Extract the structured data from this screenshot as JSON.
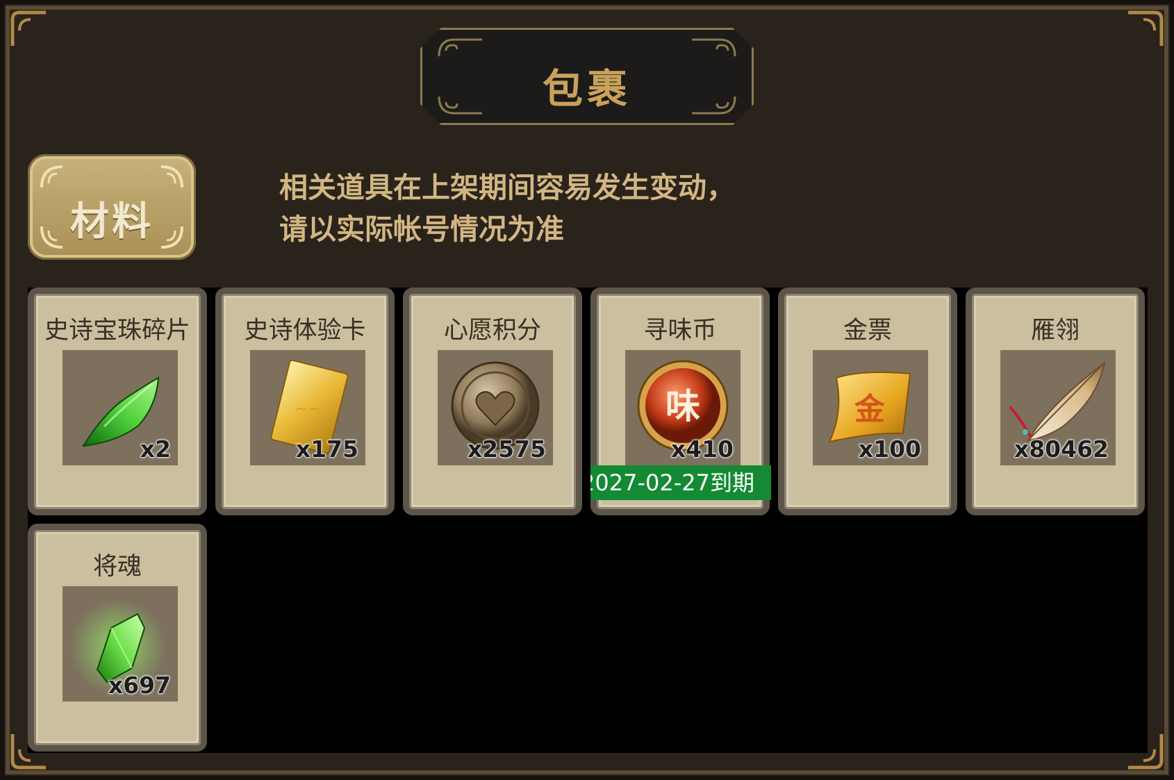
{
  "window": {
    "title": "包裹"
  },
  "category": {
    "active_tab": "材料"
  },
  "notice": {
    "line1": "相关道具在上架期间容易发生变动，",
    "line2": "请以实际帐号情况为准"
  },
  "items": [
    {
      "name": "史诗宝珠碎片",
      "qty": "x2",
      "icon": "green-gem-shard-icon"
    },
    {
      "name": "史诗体验卡",
      "qty": "x175",
      "icon": "gold-card-icon"
    },
    {
      "name": "心愿积分",
      "qty": "x2575",
      "icon": "heart-coin-icon"
    },
    {
      "name": "寻味币",
      "qty": "x410",
      "icon": "wei-coin-icon",
      "expiry": "2027-02-27到期"
    },
    {
      "name": "金票",
      "qty": "x100",
      "icon": "gold-scroll-icon"
    },
    {
      "name": "雁翎",
      "qty": "x80462",
      "icon": "feather-icon"
    },
    {
      "name": "将魂",
      "qty": "x697",
      "icon": "green-crystal-icon"
    }
  ],
  "colors": {
    "frame": "#5a4a36",
    "title_gold": "#c9a25a",
    "notice_text": "#d2b682",
    "card_bg": "#cabf9f",
    "expiry_green": "#138a33"
  }
}
